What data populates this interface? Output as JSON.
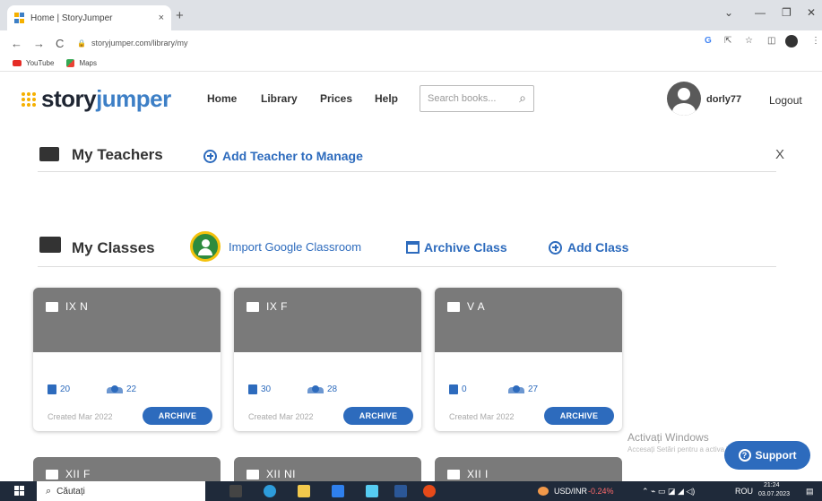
{
  "browser": {
    "tab_title": "Home | StoryJumper",
    "tab_close": "×",
    "new_tab": "+",
    "url": "storyjumper.com/library/my",
    "bookmarks": [
      "YouTube",
      "Maps"
    ]
  },
  "site": {
    "logo_story": "story",
    "logo_jumper": "jumper",
    "nav": [
      "Home",
      "Library",
      "Prices",
      "Help"
    ],
    "search_placeholder": "Search books...",
    "username": "dorly77",
    "logout": "Logout"
  },
  "teachers": {
    "title": "My Teachers",
    "add_link": "Add Teacher to Manage",
    "close": "X"
  },
  "classes": {
    "title": "My Classes",
    "import": "Import Google Classroom",
    "archive_class": "Archive Class",
    "add_class": "Add Class",
    "cards": [
      {
        "name": "IX N",
        "books": "20",
        "students": "22",
        "created": "Created Mar 2022",
        "button": "ARCHIVE"
      },
      {
        "name": "IX F",
        "books": "30",
        "students": "28",
        "created": "Created Mar 2022",
        "button": "ARCHIVE"
      },
      {
        "name": "V A",
        "books": "0",
        "students": "27",
        "created": "Created Mar 2022",
        "button": "ARCHIVE"
      }
    ],
    "cards_row2": [
      "XII F",
      "XII NI",
      "XII I"
    ]
  },
  "overlay": {
    "activate": "Activați Windows",
    "activate_sub": "Accesați Setări pentru a activa Windows.",
    "support": "Support"
  },
  "taskbar": {
    "search": "Căutați",
    "ticker_name": "USD/INR",
    "ticker_change": "-0.24%",
    "lang": "ROU",
    "time": "21:24",
    "date": "03.07.2023"
  }
}
